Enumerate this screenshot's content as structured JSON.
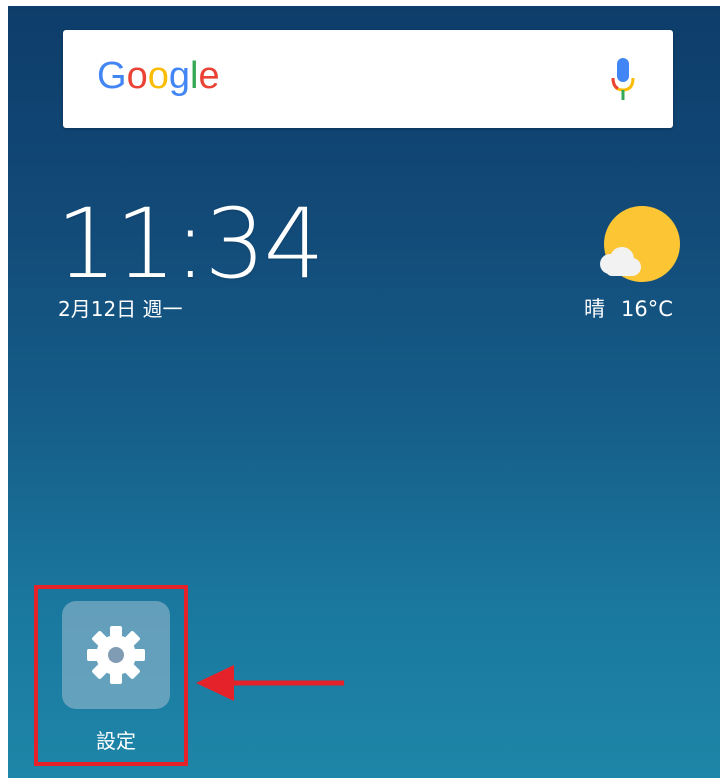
{
  "search": {
    "logo_letters": [
      "G",
      "o",
      "o",
      "g",
      "l",
      "e"
    ],
    "logo_colors": [
      "#4285F4",
      "#EA4335",
      "#FBBC05",
      "#4285F4",
      "#34A853",
      "#EA4335"
    ]
  },
  "clock": {
    "time": "11:34",
    "date": "2月12日 週一"
  },
  "weather": {
    "condition": "晴",
    "temperature": "16°C"
  },
  "app": {
    "label": "設定"
  },
  "colors": {
    "highlight": "#e5222a",
    "sun": "#fcc534"
  }
}
